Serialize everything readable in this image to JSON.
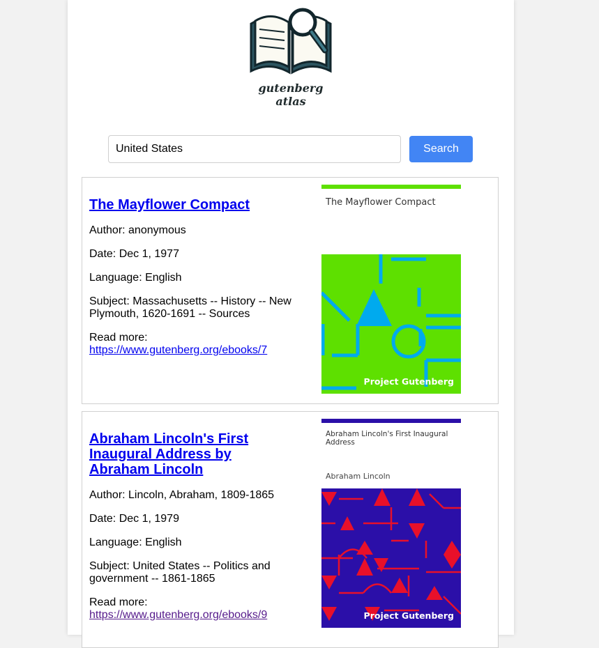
{
  "logo": {
    "text": "gutenberg atlas"
  },
  "search": {
    "value": "United States",
    "button_label": "Search"
  },
  "results": [
    {
      "title": "The Mayflower Compact",
      "author": "Author: anonymous",
      "date": "Date: Dec 1, 1977",
      "language": "Language: English",
      "subject": "Subject: Massachusetts -- History -- New Plymouth, 1620-1691 -- Sources",
      "read_more_label": "Read more:",
      "link": "https://www.gutenberg.org/ebooks/7",
      "cover": {
        "title": "The Mayflower Compact",
        "author": "",
        "brand": "Project Gutenberg",
        "accent": "#5ee000",
        "pattern": "#00aaee"
      }
    },
    {
      "title": "Abraham Lincoln's First Inaugural Address by Abraham Lincoln",
      "author": "Author: Lincoln, Abraham, 1809-1865",
      "date": "Date: Dec 1, 1979",
      "language": "Language: English",
      "subject": "Subject: United States -- Politics and government -- 1861-1865",
      "read_more_label": "Read more:",
      "link": "https://www.gutenberg.org/ebooks/9",
      "cover": {
        "title": "Abraham Lincoln's First Inaugural Address",
        "author": "Abraham Lincoln",
        "brand": "Project Gutenberg",
        "accent": "#2b0fa8",
        "pattern": "#e8102a"
      }
    }
  ]
}
